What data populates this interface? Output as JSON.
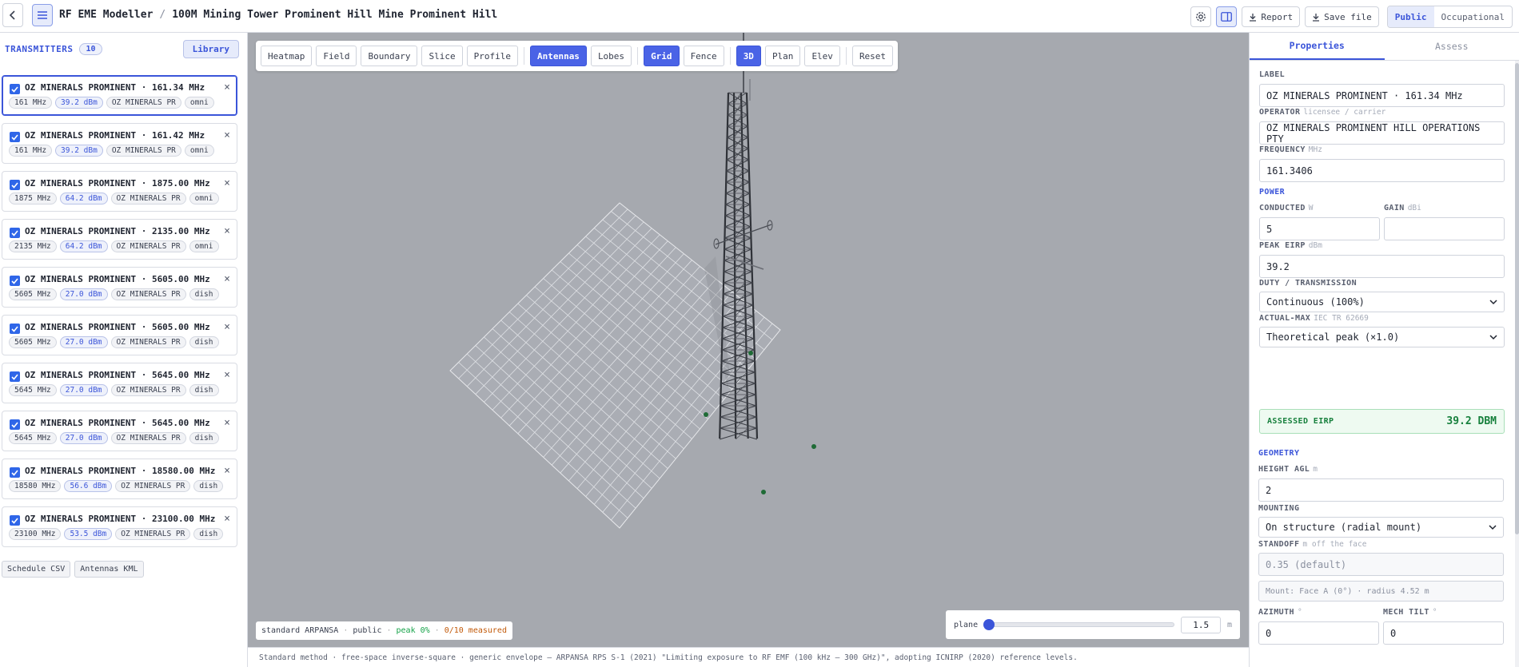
{
  "header": {
    "app_title": "RF EME Modeller",
    "crumb_sep": "/",
    "project_title": "100M Mining Tower Prominent Hill Mine Prominent Hill",
    "report_label": "Report",
    "save_label": "Save file",
    "audience_options": [
      "Public",
      "Occupational"
    ],
    "audience_selected": "Public"
  },
  "sidebar": {
    "title": "TRANSMITTERS",
    "count": "10",
    "library_label": "Library",
    "transmitters": [
      {
        "name": "OZ MINERALS PROMINENT · 161.34 MHz",
        "freq": "161 MHz",
        "power": "39.2 dBm",
        "operator": "OZ MINERALS PR",
        "type": "omni",
        "selected": true
      },
      {
        "name": "OZ MINERALS PROMINENT · 161.42 MHz",
        "freq": "161 MHz",
        "power": "39.2 dBm",
        "operator": "OZ MINERALS PR",
        "type": "omni"
      },
      {
        "name": "OZ MINERALS PROMINENT · 1875.00 MHz",
        "freq": "1875 MHz",
        "power": "64.2 dBm",
        "operator": "OZ MINERALS PR",
        "type": "omni"
      },
      {
        "name": "OZ MINERALS PROMINENT · 2135.00 MHz",
        "freq": "2135 MHz",
        "power": "64.2 dBm",
        "operator": "OZ MINERALS PR",
        "type": "omni"
      },
      {
        "name": "OZ MINERALS PROMINENT · 5605.00 MHz",
        "freq": "5605 MHz",
        "power": "27.0 dBm",
        "operator": "OZ MINERALS PR",
        "type": "dish"
      },
      {
        "name": "OZ MINERALS PROMINENT · 5605.00 MHz",
        "freq": "5605 MHz",
        "power": "27.0 dBm",
        "operator": "OZ MINERALS PR",
        "type": "dish"
      },
      {
        "name": "OZ MINERALS PROMINENT · 5645.00 MHz",
        "freq": "5645 MHz",
        "power": "27.0 dBm",
        "operator": "OZ MINERALS PR",
        "type": "dish"
      },
      {
        "name": "OZ MINERALS PROMINENT · 5645.00 MHz",
        "freq": "5645 MHz",
        "power": "27.0 dBm",
        "operator": "OZ MINERALS PR",
        "type": "dish"
      },
      {
        "name": "OZ MINERALS PROMINENT · 18580.00 MHz",
        "freq": "18580 MHz",
        "power": "56.6 dBm",
        "operator": "OZ MINERALS PR",
        "type": "dish"
      },
      {
        "name": "OZ MINERALS PROMINENT · 23100.00 MHz",
        "freq": "23100 MHz",
        "power": "53.5 dBm",
        "operator": "OZ MINERALS PR",
        "type": "dish"
      }
    ],
    "export_buttons": [
      "Schedule CSV",
      "Antennas KML"
    ]
  },
  "viewport": {
    "toolbar": [
      {
        "label": "Heatmap",
        "on": false
      },
      {
        "label": "Field",
        "on": false
      },
      {
        "label": "Boundary",
        "on": false
      },
      {
        "label": "Slice",
        "on": false
      },
      {
        "label": "Profile",
        "on": false
      },
      {
        "sep": true
      },
      {
        "label": "Antennas",
        "on": true
      },
      {
        "label": "Lobes",
        "on": false
      },
      {
        "sep": true
      },
      {
        "label": "Grid",
        "on": true
      },
      {
        "label": "Fence",
        "on": false
      },
      {
        "sep": true
      },
      {
        "label": "3D",
        "on": true
      },
      {
        "label": "Plan",
        "on": false
      },
      {
        "label": "Elev",
        "on": false
      },
      {
        "sep": true
      },
      {
        "label": "Reset",
        "on": false
      }
    ],
    "status": {
      "standard": "standard ARPANSA",
      "audience": "public",
      "peak": "peak 0%",
      "measured": "0/10 measured"
    },
    "plane": {
      "label": "plane",
      "value": "1.5",
      "unit": "m",
      "fraction": 0.0
    }
  },
  "footer_text": "Standard method · free-space inverse-square · generic envelope — ARPANSA RPS S-1 (2021) \"Limiting exposure to RF EMF (100 kHz – 300 GHz)\", adopting ICNIRP (2020) reference levels.",
  "panel": {
    "tabs": [
      "Properties",
      "Assess"
    ],
    "active_tab": "Properties",
    "label": {
      "title": "LABEL",
      "value": "OZ MINERALS PROMINENT · 161.34 MHz"
    },
    "operator": {
      "title": "OPERATOR",
      "sub": "licensee / carrier",
      "value": "OZ MINERALS PROMINENT HILL OPERATIONS PTY"
    },
    "frequency": {
      "title": "FREQUENCY",
      "sub": "MHz",
      "value": "161.3406"
    },
    "power_section": "POWER",
    "conducted": {
      "title": "CONDUCTED",
      "sub": "W",
      "value": "5"
    },
    "gain": {
      "title": "GAIN",
      "sub": "dBi",
      "value": ""
    },
    "peak_eirp": {
      "title": "PEAK EIRP",
      "sub": "dBm",
      "value": "39.2"
    },
    "duty": {
      "title": "DUTY / TRANSMISSION",
      "value": "Continuous (100%)"
    },
    "actual_max": {
      "title": "ACTUAL-MAX",
      "sub": "IEC TR 62669",
      "value": "Theoretical peak (×1.0)"
    },
    "assessed": {
      "title": "ASSESSED EIRP",
      "value": "39.2 DBM"
    },
    "geometry_section": "GEOMETRY",
    "height": {
      "title": "HEIGHT AGL",
      "sub": "m",
      "value": "2"
    },
    "mounting": {
      "title": "MOUNTING",
      "value": "On structure (radial mount)"
    },
    "standoff": {
      "title": "STANDOFF",
      "sub": "m off the face",
      "value": "0.35 (default)"
    },
    "mount_note": "Mount: Face A (0°) · radius 4.52 m",
    "azimuth": {
      "title": "AZIMUTH",
      "sub": "°",
      "value": "0"
    },
    "mech_tilt": {
      "title": "MECH TILT",
      "sub": "°",
      "value": "0"
    }
  }
}
